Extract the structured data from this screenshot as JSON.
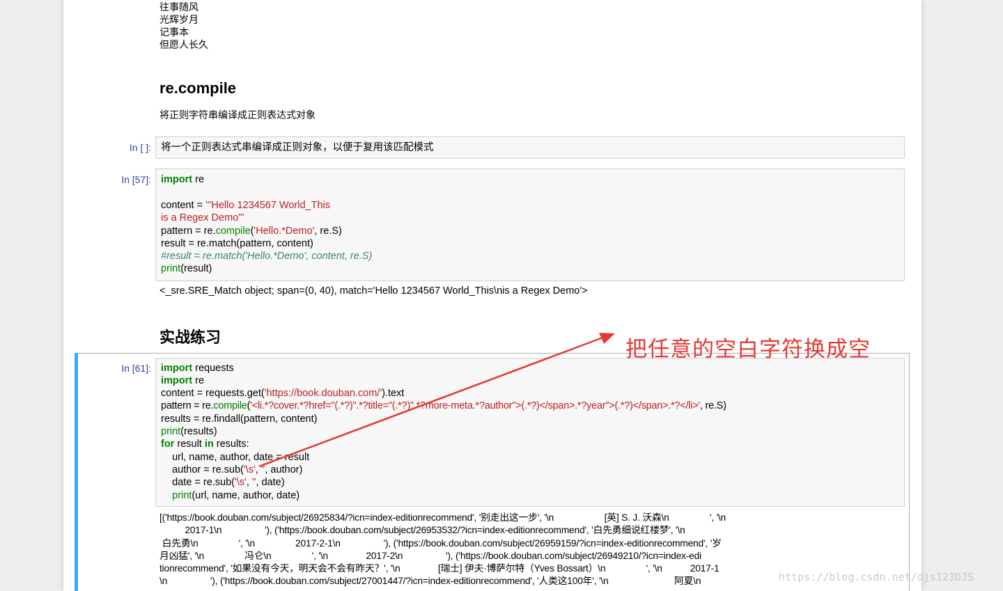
{
  "markdown_top": [
    "往事随风",
    "光辉岁月",
    "记事本",
    "但愿人长久"
  ],
  "section_recompile": {
    "title": "re.compile",
    "desc": "将正则字符串编译成正则表达式对象"
  },
  "cell_1": {
    "prompt": "In [ ]:",
    "code": "将一个正则表达式串编译成正则对象，以便于复用该匹配模式"
  },
  "cell_2": {
    "prompt": "In [57]:",
    "lines": {
      "l1_kw": "import",
      "l1_rest": " re",
      "l3_a": "content = ",
      "l3_b": "'''Hello 1234567 World_This",
      "l4": "is a Regex Demo'''",
      "l5_a": "pattern = re.",
      "l5_b": "compile",
      "l5_c": "(",
      "l5_d": "'Hello.*Demo'",
      "l5_e": ", re.S)",
      "l6": "result = re.match(pattern, content)",
      "l7": "#result = re.match('Hello.*Demo', content, re.S)",
      "l8_a": "print",
      "l8_b": "(result)"
    },
    "output": "<_sre.SRE_Match object; span=(0, 40), match='Hello 1234567 World_This\\nis a Regex Demo'>"
  },
  "section_practice": {
    "title": "实战练习"
  },
  "cell_3": {
    "prompt": "In [61]:",
    "lines": {
      "l1_kw": "import",
      "l1_rest": " requests",
      "l2_kw": "import",
      "l2_rest": " re",
      "l3_a": "content = requests.get(",
      "l3_b": "'https://book.douban.com/'",
      "l3_c": ").text",
      "l4_a": "pattern = re.",
      "l4_b": "compile",
      "l4_c": "(",
      "l4_d": "'<li.*?cover.*?href=\"(.*?)\".*?title=\"(.*?)\".*?more-meta.*?author\">(.*?)</span>.*?year\">(.*?)</span>.*?</li>'",
      "l4_e": ", re.S)",
      "l5": "results = re.findall(pattern, content)",
      "l6_a": "print",
      "l6_b": "(results)",
      "l7_kw1": "for",
      "l7_mid": " result ",
      "l7_kw2": "in",
      "l7_rest": " results:",
      "l8": "    url, name, author, date = result",
      "l9_a": "    author = re.sub(",
      "l9_b": "'\\s'",
      "l9_c": ", ",
      "l9_d": "''",
      "l9_e": ", author)",
      "l10_a": "    date = re.sub(",
      "l10_b": "'\\s'",
      "l10_c": ", ",
      "l10_d": "''",
      "l10_e": ", date)",
      "l11_a": "    ",
      "l11_b": "print",
      "l11_c": "(url, name, author, date)"
    },
    "output_lines": [
      "[('https://book.douban.com/subject/26925834/?icn=index-editionrecommend', '别走出这一步', '\\n                    [英] S. J. 沃森\\n                ', '\\n",
      "          2017-1\\n                 '), ('https://book.douban.com/subject/26953532/?icn=index-editionrecommend', '白先勇细说红楼梦', '\\n",
      " 白先勇\\n                ', '\\n                2017-2-1\\n                 '), ('https://book.douban.com/subject/26959159/?icn=index-editionrecommend', '岁",
      "月凶猛', '\\n                冯仑\\n                ', '\\n               2017-2\\n                 '), ('https://book.douban.com/subject/26949210/?icn=index-edi",
      "tionrecommend', '如果没有今天，明天会不会有昨天？', '\\n               [瑞士] 伊夫·博萨尔特（Yves Bossart）\\n                ', '\\n           2017-1",
      "\\n                 '), ('https://book.douban.com/subject/27001447/?icn=index-editionrecommend', '人类这100年', '\\n                          阿夏\\n"
    ]
  },
  "annotation": {
    "text": "把任意的空白字符换成空",
    "color": "#e53935"
  },
  "watermark": {
    "text": "https://blog.csdn.net/djs123DJS"
  }
}
